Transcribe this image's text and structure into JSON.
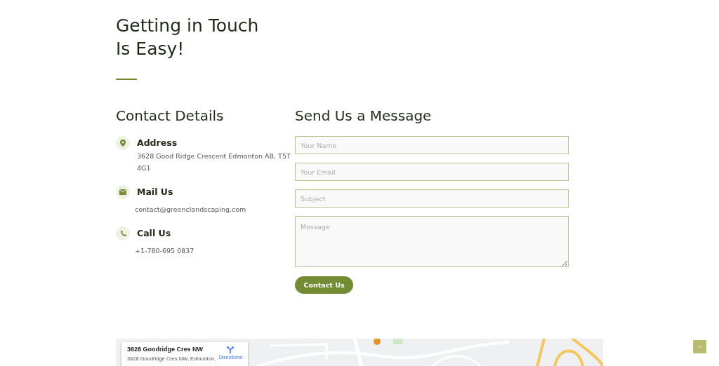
{
  "heading": {
    "lines": [
      "Getting in Touch",
      "Is Easy!"
    ]
  },
  "contact_details": {
    "title": "Contact Details",
    "items": [
      {
        "kind": "address",
        "label": "Address",
        "value": "3628 Good Ridge Crescent Edmonton AB, T5T 4G1"
      },
      {
        "kind": "mail",
        "label": "Mail Us",
        "value": "contact@greenclandscaping.com"
      },
      {
        "kind": "phone",
        "label": "Call Us",
        "value": "+1-780-695 0837"
      }
    ]
  },
  "message_form": {
    "title": "Send Us a Message",
    "fields": [
      {
        "kind": "input",
        "placeholder": "Your Name"
      },
      {
        "kind": "input",
        "placeholder": "Your Email"
      },
      {
        "kind": "input",
        "placeholder": "Subject"
      },
      {
        "kind": "textarea",
        "placeholder": "Message"
      }
    ],
    "submit": "Contact Us"
  },
  "map": {
    "kind": "picture",
    "card": {
      "title": "3628 Goodridge Cres NW",
      "address": "3628 Goodridge Cres NW, Edmonton,",
      "directions": "Directions"
    }
  }
}
